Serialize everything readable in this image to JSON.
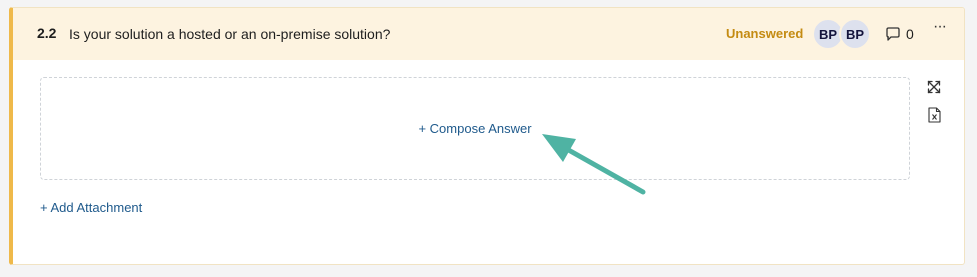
{
  "question": {
    "number": "2.2",
    "text": "Is your solution a hosted or an on-premise solution?",
    "status": "Unanswered",
    "assignees": [
      {
        "initials": "BP"
      },
      {
        "initials": "BP"
      }
    ],
    "comment_count": "0",
    "more_label": "···"
  },
  "answer": {
    "compose_label": "+ Compose Answer"
  },
  "attachment": {
    "add_label": "+ Add Attachment"
  },
  "colors": {
    "accent_border": "#efb94a",
    "header_bg": "#fdf3e0",
    "status": "#c48b12",
    "link": "#1f5a8c",
    "annotation_arrow": "#4fb3a3"
  },
  "icons": [
    "comment-icon",
    "more-options-icon",
    "expand-icon",
    "file-export-icon",
    "annotation-arrow"
  ]
}
